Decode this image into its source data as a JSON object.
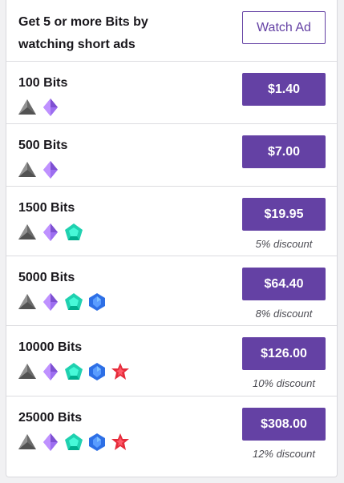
{
  "header": {
    "line1": "Get 5 or more Bits by",
    "line2": "watching short ads",
    "watch_ad_label": "Watch Ad"
  },
  "offers": [
    {
      "label": "100 Bits",
      "price": "$1.40",
      "discount": "",
      "gems": [
        "gray-triangle-gem-icon",
        "purple-diamond-gem-icon"
      ]
    },
    {
      "label": "500 Bits",
      "price": "$7.00",
      "discount": "",
      "gems": [
        "gray-triangle-gem-icon",
        "purple-diamond-gem-icon"
      ]
    },
    {
      "label": "1500 Bits",
      "price": "$19.95",
      "discount": "5% discount",
      "gems": [
        "gray-triangle-gem-icon",
        "purple-diamond-gem-icon",
        "teal-pentagon-gem-icon"
      ]
    },
    {
      "label": "5000 Bits",
      "price": "$64.40",
      "discount": "8% discount",
      "gems": [
        "gray-triangle-gem-icon",
        "purple-diamond-gem-icon",
        "teal-pentagon-gem-icon",
        "blue-hexagon-gem-icon"
      ]
    },
    {
      "label": "10000 Bits",
      "price": "$126.00",
      "discount": "10% discount",
      "gems": [
        "gray-triangle-gem-icon",
        "purple-diamond-gem-icon",
        "teal-pentagon-gem-icon",
        "blue-hexagon-gem-icon",
        "red-star-gem-icon"
      ]
    },
    {
      "label": "25000 Bits",
      "price": "$308.00",
      "discount": "12% discount",
      "gems": [
        "gray-triangle-gem-icon",
        "purple-diamond-gem-icon",
        "teal-pentagon-gem-icon",
        "blue-hexagon-gem-icon",
        "red-star-gem-icon"
      ]
    }
  ],
  "colors": {
    "accent": "#6441a4",
    "gem_gray": "#6b6b6b",
    "gem_purple": "#9c6ef0",
    "gem_teal": "#1fd1b0",
    "gem_blue": "#2d6fe6",
    "gem_red": "#e52b3a"
  }
}
